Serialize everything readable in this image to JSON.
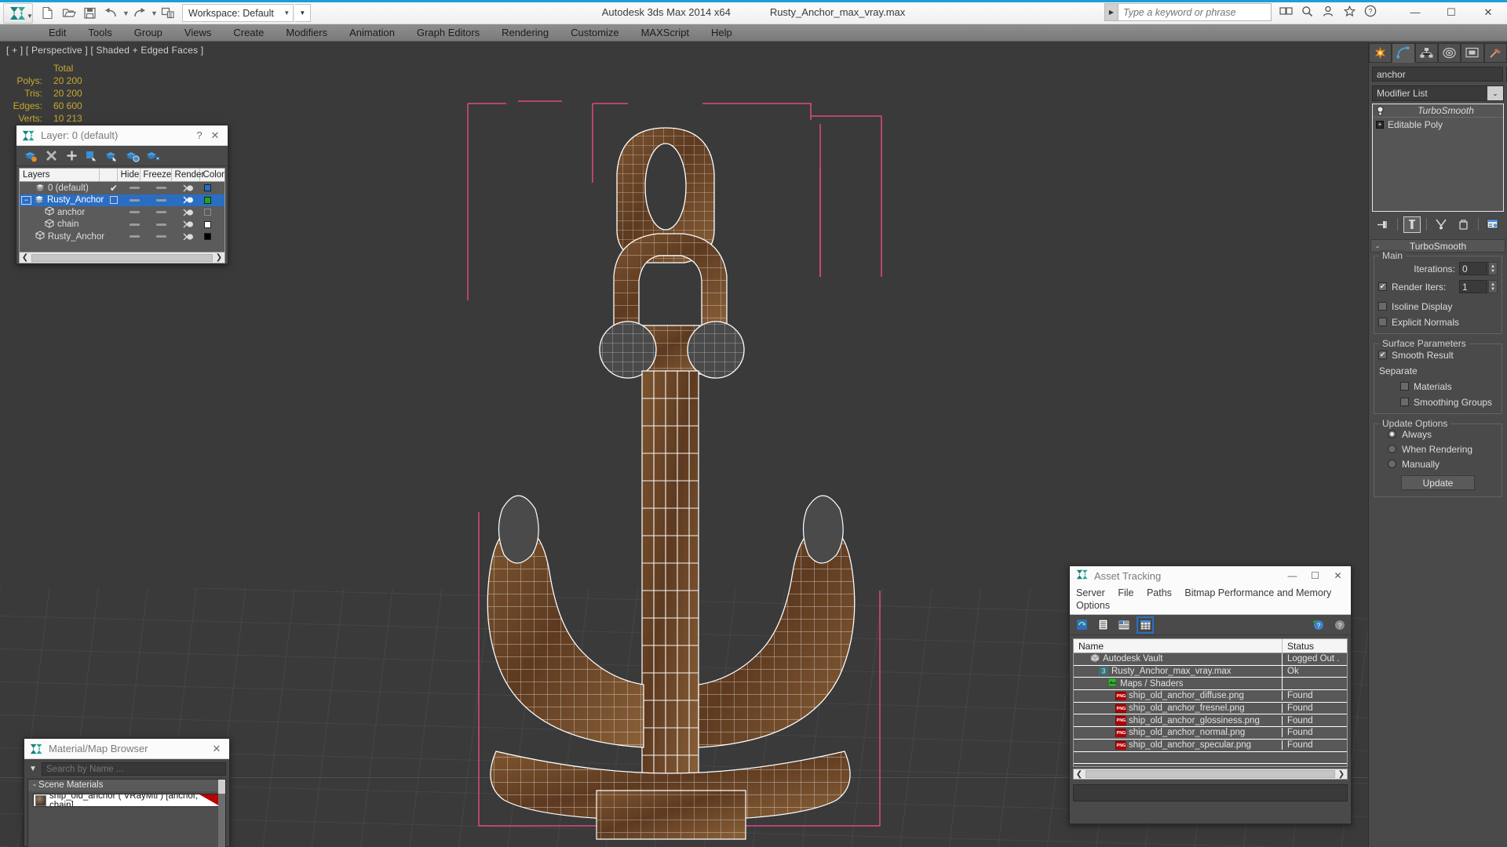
{
  "titlebar": {
    "app_title": "Autodesk 3ds Max  2014 x64",
    "file_name": "Rusty_Anchor_max_vray.max",
    "workspace_label": "Workspace: Default",
    "search_placeholder": "Type a keyword or phrase",
    "minimize": "—",
    "maximize": "☐",
    "close": "✕"
  },
  "menubar": {
    "items": [
      "Edit",
      "Tools",
      "Group",
      "Views",
      "Create",
      "Modifiers",
      "Animation",
      "Graph Editors",
      "Rendering",
      "Customize",
      "MAXScript",
      "Help"
    ]
  },
  "viewport": {
    "label": "[ + ] [ Perspective ] [ Shaded + Edged Faces ]",
    "stats_header": "Total",
    "stats": [
      {
        "label": "Polys:",
        "value": "20 200"
      },
      {
        "label": "Tris:",
        "value": "20 200"
      },
      {
        "label": "Edges:",
        "value": "60 600"
      },
      {
        "label": "Verts:",
        "value": "10 213"
      }
    ]
  },
  "layers_dialog": {
    "title": "Layer: 0 (default)",
    "help_btn": "?",
    "close_btn": "✕",
    "columns": [
      "Layers",
      "",
      "Hide",
      "Freeze",
      "Render",
      "Color"
    ],
    "rows": [
      {
        "name": "0 (default)",
        "indent": 0,
        "icon": "layer-icon",
        "selected": false,
        "check": "✔",
        "color": "#1f6fd0"
      },
      {
        "name": "Rusty_Anchor",
        "indent": 0,
        "icon": "layer-icon",
        "selected": true,
        "check": "box",
        "color": "#1fa814"
      },
      {
        "name": "anchor",
        "indent": 1,
        "icon": "object-icon",
        "selected": false,
        "check": "",
        "color": "none"
      },
      {
        "name": "chain",
        "indent": 1,
        "icon": "object-icon",
        "selected": false,
        "check": "",
        "color": "#ffffff"
      },
      {
        "name": "Rusty_Anchor",
        "indent": 1,
        "icon": "object-icon",
        "selected": false,
        "check": "",
        "color": "#000000"
      }
    ]
  },
  "material_browser": {
    "title": "Material/Map Browser",
    "close_btn": "✕",
    "search_placeholder": "Search by Name ...",
    "group_label": "- Scene Materials",
    "material": "ship_old_anchor  ( VRayMtl )  [anchor, chain]"
  },
  "asset_tracking": {
    "title": "Asset Tracking",
    "minimize": "—",
    "maximize": "☐",
    "close": "✕",
    "menu_items": [
      "Server",
      "File",
      "Paths",
      "Bitmap Performance and Memory",
      "Options"
    ],
    "columns": {
      "name": "Name",
      "status": "Status"
    },
    "rows": [
      {
        "name": "Autodesk Vault",
        "status": "Logged Out .",
        "indent": 1,
        "icon": "vault-icon"
      },
      {
        "name": "Rusty_Anchor_max_vray.max",
        "status": "Ok",
        "indent": 2,
        "icon": "max-file-icon"
      },
      {
        "name": "Maps / Shaders",
        "status": "",
        "indent": 3,
        "icon": "maps-icon"
      },
      {
        "name": "ship_old_anchor_diffuse.png",
        "status": "Found",
        "indent": 4,
        "icon": "png-icon"
      },
      {
        "name": "ship_old_anchor_fresnel.png",
        "status": "Found",
        "indent": 4,
        "icon": "png-icon"
      },
      {
        "name": "ship_old_anchor_glossiness.png",
        "status": "Found",
        "indent": 4,
        "icon": "png-icon"
      },
      {
        "name": "ship_old_anchor_normal.png",
        "status": "Found",
        "indent": 4,
        "icon": "png-icon"
      },
      {
        "name": "ship_old_anchor_specular.png",
        "status": "Found",
        "indent": 4,
        "icon": "png-icon"
      }
    ]
  },
  "command_panel": {
    "object_name": "anchor",
    "modifier_list_label": "Modifier List",
    "stack": [
      {
        "label": "TurboSmooth",
        "italic": true
      },
      {
        "label": "Editable Poly",
        "italic": false
      }
    ],
    "rollup": {
      "title": "TurboSmooth",
      "collapse_glyph": "-",
      "main_legend": "Main",
      "iterations_label": "Iterations:",
      "iterations_value": "0",
      "render_iters_label": "Render Iters:",
      "render_iters_value": "1",
      "render_iters_checked": true,
      "isoline_label": "Isoline Display",
      "isoline_checked": false,
      "explicit_normals_label": "Explicit Normals",
      "explicit_normals_checked": false,
      "surface_legend": "Surface Parameters",
      "smooth_result_label": "Smooth Result",
      "smooth_result_checked": true,
      "separate_label": "Separate",
      "materials_label": "Materials",
      "materials_checked": false,
      "smoothing_groups_label": "Smoothing Groups",
      "smoothing_groups_checked": false,
      "update_legend": "Update Options",
      "update_options": [
        {
          "label": "Always",
          "selected": true
        },
        {
          "label": "When Rendering",
          "selected": false
        },
        {
          "label": "Manually",
          "selected": false
        }
      ],
      "update_button": "Update"
    }
  },
  "colors": {
    "accent_blue": "#1b9fd8",
    "selection_blue": "#2a6ec4",
    "stat_yellow": "#c8a832",
    "viewport_bg": "#3a3a3a",
    "panel_bg": "#4a4a4a",
    "pink_gizmo": "#e0497f",
    "rust_brown": "#6b4426"
  }
}
